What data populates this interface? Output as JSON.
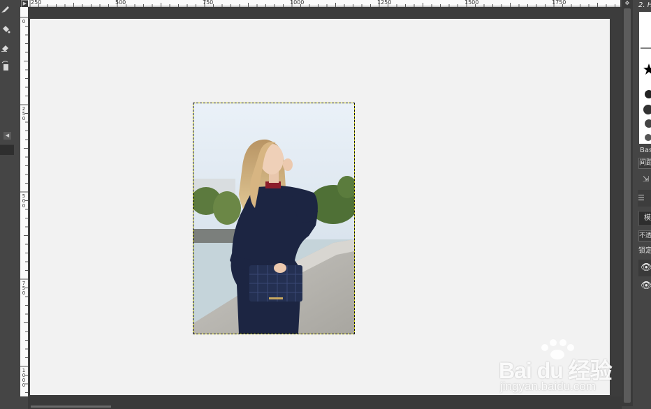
{
  "ruler": {
    "h_labels": [
      "250",
      "500",
      "750",
      "1000",
      "1250",
      "1500",
      "1750"
    ],
    "v_labels": [
      "0",
      "250",
      "500",
      "750",
      "1000"
    ]
  },
  "toolbox": {
    "tools": [
      "pencil-icon",
      "bucket-fill-icon",
      "eraser-icon",
      "airbrush-icon"
    ],
    "collapse_glyph": "◀"
  },
  "canvas": {
    "image_description": "Woman in navy sweater holding handbag by a river",
    "background_color": "#f2f2f2",
    "selection_color": "#e8e800"
  },
  "dock": {
    "brush_title": "2. H",
    "brush_name": "Bas",
    "brush_spacing": "间距",
    "mode_label": "模",
    "opacity_label": "不透",
    "lock_label": "锁定"
  },
  "watermark": {
    "main": "Bai du 经验",
    "sub": "jingyan.baidu.com"
  }
}
